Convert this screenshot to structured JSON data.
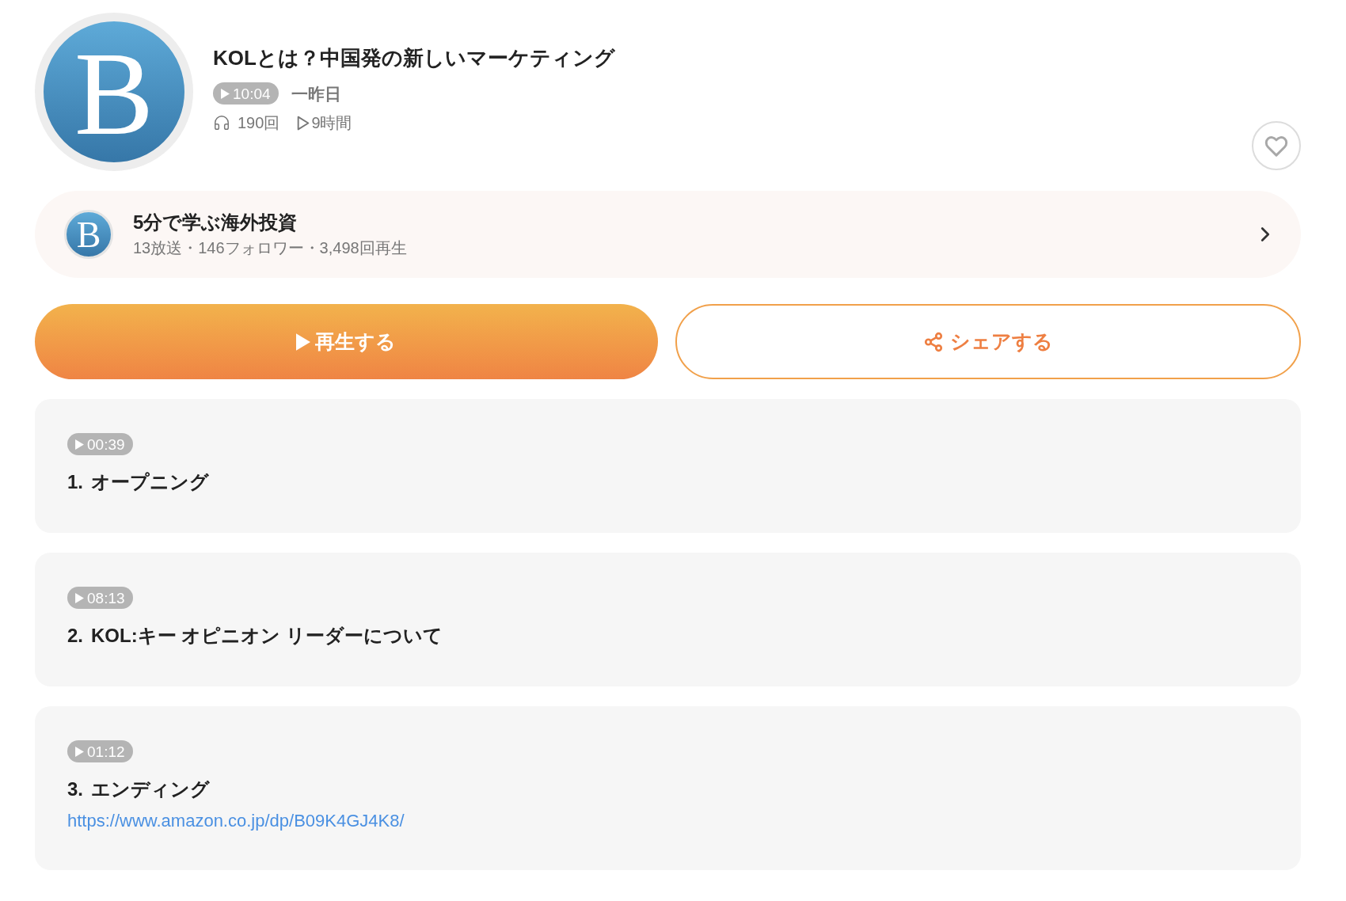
{
  "episode": {
    "cover_letter": "B",
    "title": "KOLとは？中国発の新しいマーケティング",
    "duration": "10:04",
    "date": "一昨日",
    "plays": "190回",
    "total_time": "9時間",
    "favorited": false
  },
  "channel": {
    "avatar_letter": "B",
    "name": "5分で学ぶ海外投資",
    "meta": "13放送・146フォロワー・3,498回再生"
  },
  "buttons": [
    {
      "kind": "play",
      "label": "再生する"
    },
    {
      "kind": "share",
      "label": "シェアする"
    }
  ],
  "chapters": [
    {
      "time": "00:39",
      "number": "1.",
      "title": "オープニング"
    },
    {
      "time": "08:13",
      "number": "2.",
      "title": "KOL:キー オピニオン リーダーについて"
    },
    {
      "time": "01:12",
      "number": "3.",
      "title": "エンディング",
      "link": "https://www.amazon.co.jp/dp/B09K4GJ4K8/"
    }
  ]
}
